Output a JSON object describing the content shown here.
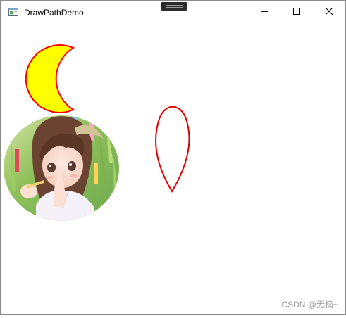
{
  "window": {
    "title": "DrawPathDemo"
  },
  "controls": {
    "minimize_icon": "minimize-icon",
    "maximize_icon": "maximize-icon",
    "close_icon": "close-icon"
  },
  "shapes": {
    "moon": {
      "fill": "#ffff00",
      "stroke": "#ff0000"
    },
    "teardrop": {
      "stroke": "#e00000"
    }
  },
  "colors": {
    "titlebar_bg": "#ffffff",
    "canvas_bg": "#ffffff",
    "watermark": "#9c9c9c"
  },
  "watermark": {
    "text": "CSDN @无楠~"
  }
}
